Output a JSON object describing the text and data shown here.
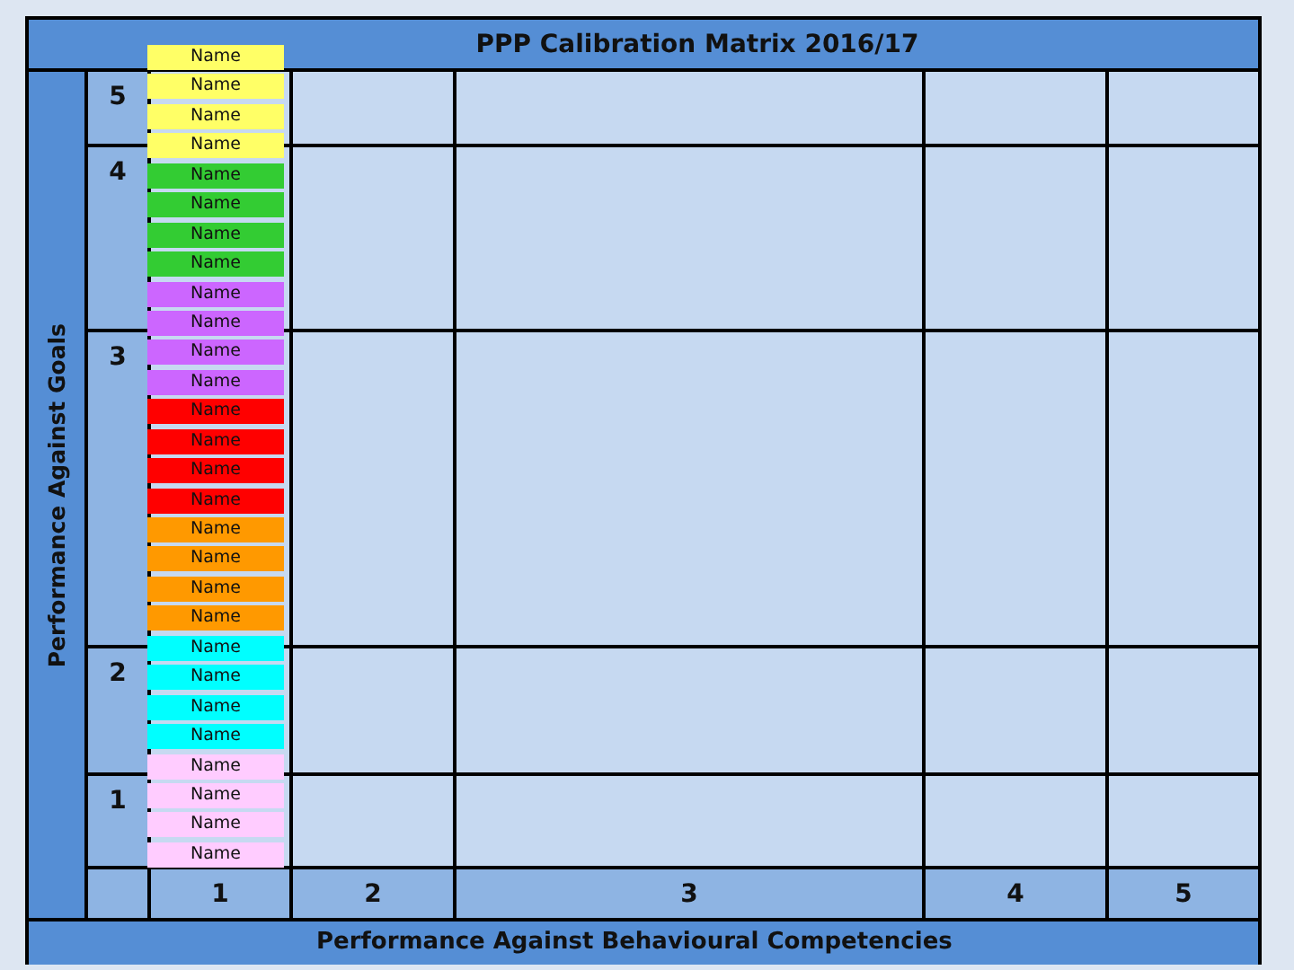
{
  "title": "PPP Calibration Matrix 2016/17",
  "y_axis": {
    "label": "Performance Against Goals",
    "levels": [
      "5",
      "4",
      "3",
      "2",
      "1"
    ]
  },
  "x_axis": {
    "label": "Performance Against Behavioural Competencies",
    "levels": [
      "1",
      "2",
      "3",
      "4",
      "5"
    ]
  },
  "name_tags": [
    {
      "text": "Name",
      "color": "#ffff66"
    },
    {
      "text": "Name",
      "color": "#ffff66"
    },
    {
      "text": "Name",
      "color": "#ffff66"
    },
    {
      "text": "Name",
      "color": "#ffff66"
    },
    {
      "text": "Name",
      "color": "#33cc33"
    },
    {
      "text": "Name",
      "color": "#33cc33"
    },
    {
      "text": "Name",
      "color": "#33cc33"
    },
    {
      "text": "Name",
      "color": "#33cc33"
    },
    {
      "text": "Name",
      "color": "#cc66ff"
    },
    {
      "text": "Name",
      "color": "#cc66ff"
    },
    {
      "text": "Name",
      "color": "#cc66ff"
    },
    {
      "text": "Name",
      "color": "#cc66ff"
    },
    {
      "text": "Name",
      "color": "#ff0000"
    },
    {
      "text": "Name",
      "color": "#ff0000"
    },
    {
      "text": "Name",
      "color": "#ff0000"
    },
    {
      "text": "Name",
      "color": "#ff0000"
    },
    {
      "text": "Name",
      "color": "#ff9900"
    },
    {
      "text": "Name",
      "color": "#ff9900"
    },
    {
      "text": "Name",
      "color": "#ff9900"
    },
    {
      "text": "Name",
      "color": "#ff9900"
    },
    {
      "text": "Name",
      "color": "#00ffff"
    },
    {
      "text": "Name",
      "color": "#00ffff"
    },
    {
      "text": "Name",
      "color": "#00ffff"
    },
    {
      "text": "Name",
      "color": "#00ffff"
    },
    {
      "text": "Name",
      "color": "#ffccff"
    },
    {
      "text": "Name",
      "color": "#ffccff"
    },
    {
      "text": "Name",
      "color": "#ffccff"
    },
    {
      "text": "Name",
      "color": "#ffccff"
    }
  ]
}
